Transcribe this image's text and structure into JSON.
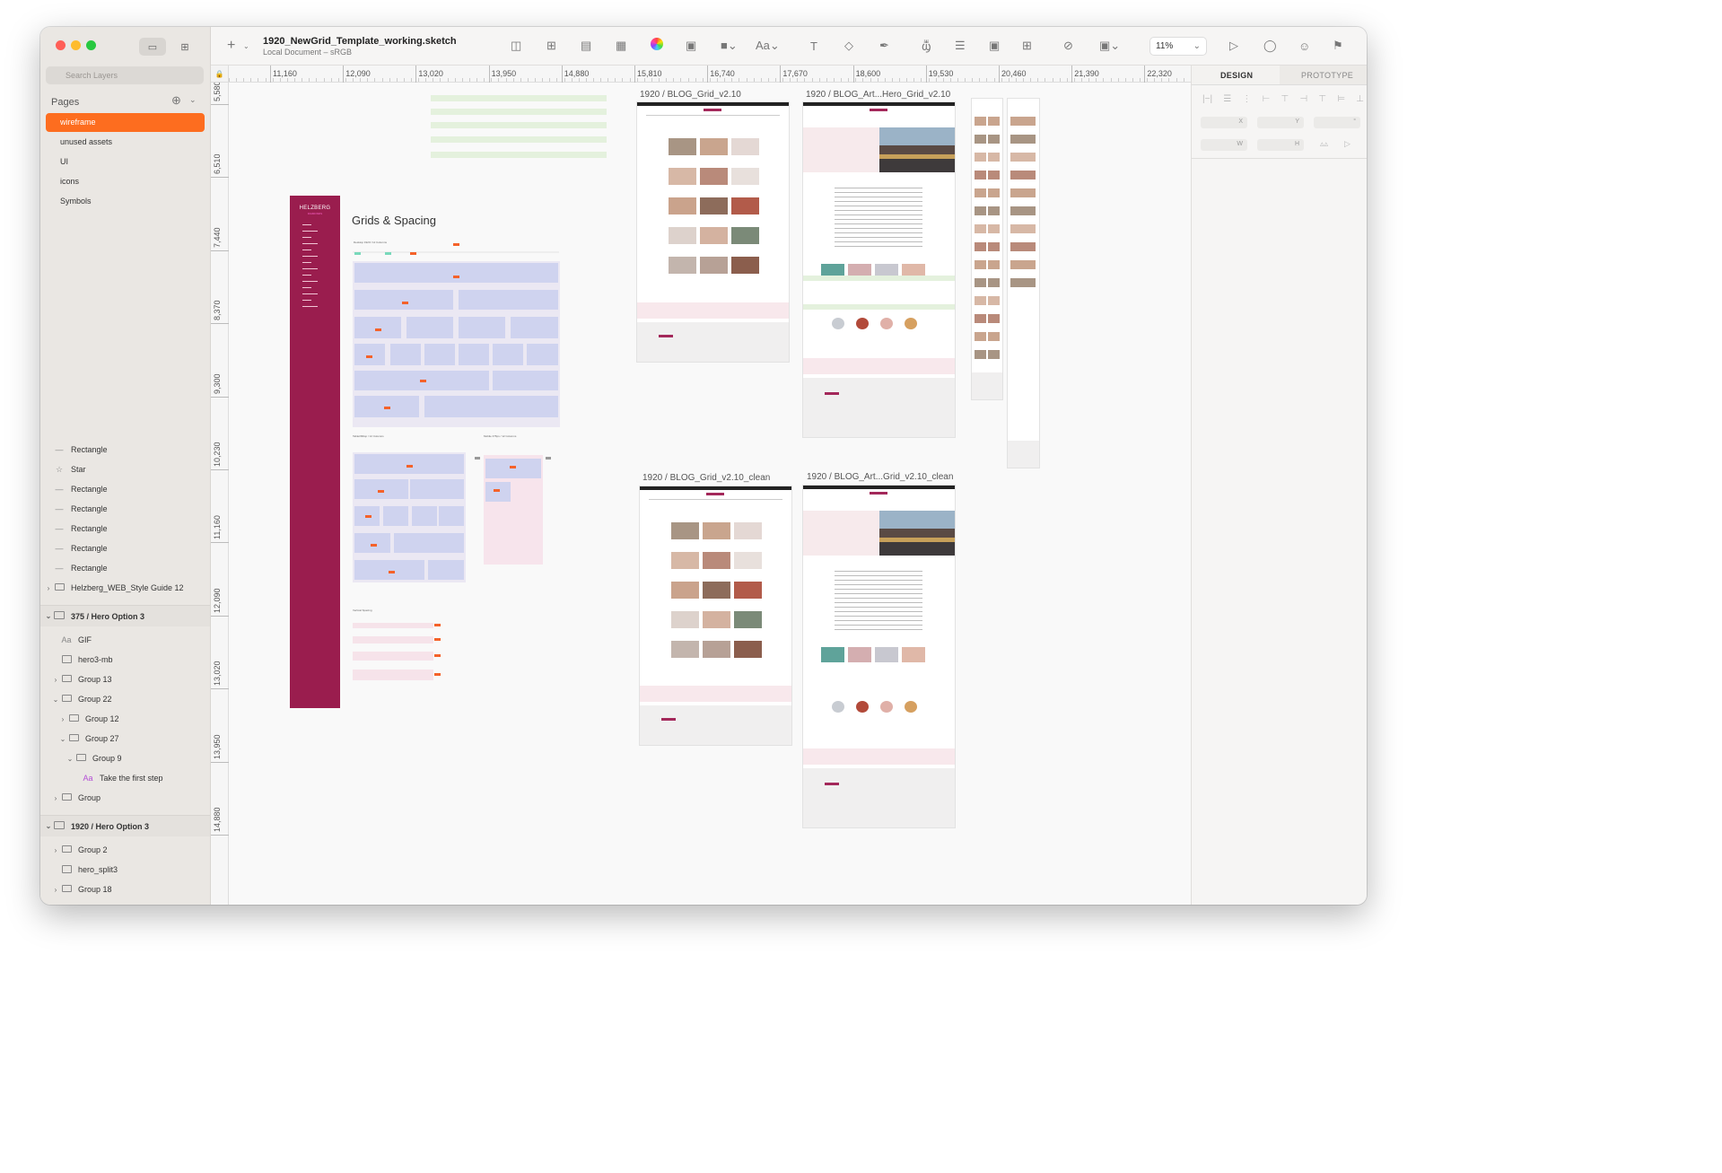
{
  "document": {
    "title": "1920_NewGrid_Template_working.sketch",
    "subtitle": "Local Document – sRGB",
    "zoom": "11%"
  },
  "sidebar": {
    "search_placeholder": "Search Layers",
    "pages_label": "Pages",
    "pages": [
      {
        "label": "wireframe",
        "selected": true
      },
      {
        "label": "unused assets"
      },
      {
        "label": "UI"
      },
      {
        "label": "icons"
      },
      {
        "label": "Symbols"
      }
    ],
    "layers": [
      {
        "label": "Rectangle",
        "icon": "line-icon"
      },
      {
        "label": "Star",
        "icon": "star-icon"
      },
      {
        "label": "Rectangle",
        "icon": "line-icon"
      },
      {
        "label": "Rectangle",
        "icon": "line-icon"
      },
      {
        "label": "Rectangle",
        "icon": "line-icon"
      },
      {
        "label": "Rectangle",
        "icon": "line-icon"
      },
      {
        "label": "Rectangle",
        "icon": "line-icon"
      },
      {
        "label": "Helzberg_WEB_Style Guide 12",
        "icon": "folder-icon"
      },
      {
        "label": "375 / Hero Option 3",
        "icon": "artboard-icon"
      },
      {
        "label": "GIF",
        "icon": "text-icon"
      },
      {
        "label": "hero3-mb",
        "icon": "image-icon"
      },
      {
        "label": "Group 13",
        "icon": "folder-icon"
      },
      {
        "label": "Group 22",
        "icon": "folder-icon"
      },
      {
        "label": "Group 12",
        "icon": "folder-icon"
      },
      {
        "label": "Group 27",
        "icon": "folder-icon"
      },
      {
        "label": "Group 9",
        "icon": "folder-icon"
      },
      {
        "label": "Take the first step",
        "icon": "text-icon"
      },
      {
        "label": "Group",
        "icon": "folder-icon"
      },
      {
        "label": "1920 / Hero Option 3",
        "icon": "artboard-icon"
      },
      {
        "label": "Group 2",
        "icon": "folder-icon"
      },
      {
        "label": "hero_split3",
        "icon": "image-icon"
      },
      {
        "label": "Group 18",
        "icon": "folder-icon"
      }
    ]
  },
  "ruler": {
    "h_labels": [
      "11,160",
      "12,090",
      "13,020",
      "13,950",
      "14,880",
      "15,810",
      "16,740",
      "17,670",
      "18,600",
      "19,530",
      "20,460",
      "21,390",
      "22,320"
    ],
    "v_labels": [
      "5,580",
      "6,510",
      "7,440",
      "8,370",
      "9,300",
      "10,230",
      "11,160",
      "12,090",
      "13,020",
      "13,950",
      "14,880"
    ]
  },
  "inspector": {
    "tab_design": "DESIGN",
    "tab_prototype": "PROTOTYPE",
    "x_label": "X",
    "y_label": "Y",
    "w_label": "W",
    "h_label": "H"
  },
  "canvas": {
    "artboards": [
      "1920 / BLOG_Grid_v2.10",
      "1920 / BLOG_Art...Hero_Grid_v2.10",
      "1920 / BLOG_Grid_v2.10_clean",
      "1920 / BLOG_Art...Grid_v2.10_clean"
    ],
    "grids_title": "Grids & Spacing",
    "sidebar_brand": "HELZBERG",
    "sidebar_brand_sub": "DIAMONDS",
    "grid_caption_desktop": "Desktop 1920 / 12 Columns",
    "grid_caption_tablet": "Tablet/Mbsp / 12 Columns",
    "grid_caption_mobile": "Mobile 375px / 12 Columns",
    "vertical_spacing": "Vertical Spacing"
  }
}
